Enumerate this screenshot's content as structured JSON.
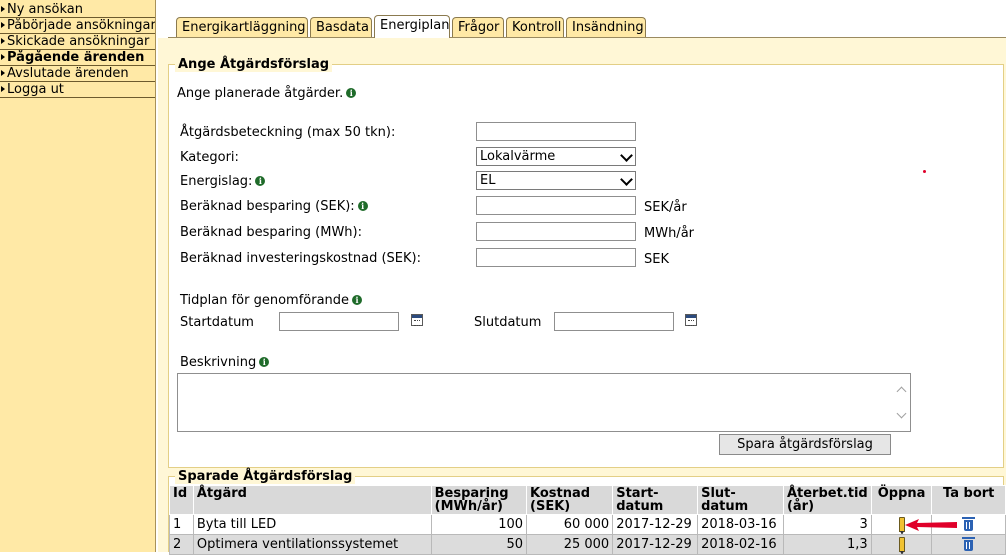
{
  "sidebar": {
    "items": [
      {
        "label": "Ny ansökan",
        "bold": false
      },
      {
        "label": "Påbörjade ansökningar",
        "bold": false
      },
      {
        "label": "Skickade ansökningar",
        "bold": false
      },
      {
        "label": "Pågående ärenden",
        "bold": true
      },
      {
        "label": "Avslutade ärenden",
        "bold": false
      },
      {
        "label": "Logga ut",
        "bold": false
      }
    ]
  },
  "tabs": [
    {
      "label": "Energikartläggning",
      "active": false
    },
    {
      "label": "Basdata",
      "active": false
    },
    {
      "label": "Energiplan",
      "active": true
    },
    {
      "label": "Frågor",
      "active": false
    },
    {
      "label": "Kontroll",
      "active": false
    },
    {
      "label": "Insändning",
      "active": false
    }
  ],
  "form": {
    "legend": "Ange Åtgärdsförslag",
    "intro": "Ange planerade åtgärder.",
    "fields": {
      "beteckning_label": "Åtgärdsbeteckning (max 50 tkn):",
      "beteckning_value": "",
      "kategori_label": "Kategori:",
      "kategori_value": "Lokalvärme",
      "energislag_label": "Energislag:",
      "energislag_value": "EL",
      "besparing_sek_label": "Beräknad besparing (SEK):",
      "besparing_sek_value": "",
      "besparing_sek_unit": "SEK/år",
      "besparing_mwh_label": "Beräknad besparing (MWh):",
      "besparing_mwh_value": "",
      "besparing_mwh_unit": "MWh/år",
      "invest_label": "Beräknad investeringskostnad (SEK):",
      "invest_value": "",
      "invest_unit": "SEK"
    },
    "schedule": {
      "heading": "Tidplan för genomförande",
      "start_label": "Startdatum",
      "start_value": "",
      "end_label": "Slutdatum",
      "end_value": ""
    },
    "description": {
      "label": "Beskrivning",
      "value": ""
    },
    "save_button": "Spara åtgärdsförslag"
  },
  "saved": {
    "legend": "Sparade Åtgärdsförslag",
    "headers": {
      "id": "Id",
      "atgard": "Åtgärd",
      "besparing": "Besparing (MWh/år)",
      "kostnad": "Kostnad (SEK)",
      "start": "Start-datum",
      "slut": "Slut-datum",
      "aterbet": "Återbet.tid (år)",
      "oppna": "Öppna",
      "tabort": "Ta bort"
    },
    "rows": [
      {
        "id": "1",
        "atgard": "Byta till LED",
        "besparing": "100",
        "kostnad": "60 000",
        "start": "2017-12-29",
        "slut": "2018-03-16",
        "aterbet": "3"
      },
      {
        "id": "2",
        "atgard": "Optimera ventilationssystemet",
        "besparing": "50",
        "kostnad": "25 000",
        "start": "2017-12-29",
        "slut": "2018-02-16",
        "aterbet": "1,3"
      }
    ]
  },
  "colors": {
    "sidebar_bg": "#ffe9a6",
    "info_icon": "#1f6b2a",
    "arrow": "#e0002a",
    "trash_icon": "#2c62b3"
  },
  "icons": {
    "info": "info-icon",
    "calendar": "calendar-icon",
    "edit": "pencil-icon",
    "delete": "trash-icon"
  }
}
